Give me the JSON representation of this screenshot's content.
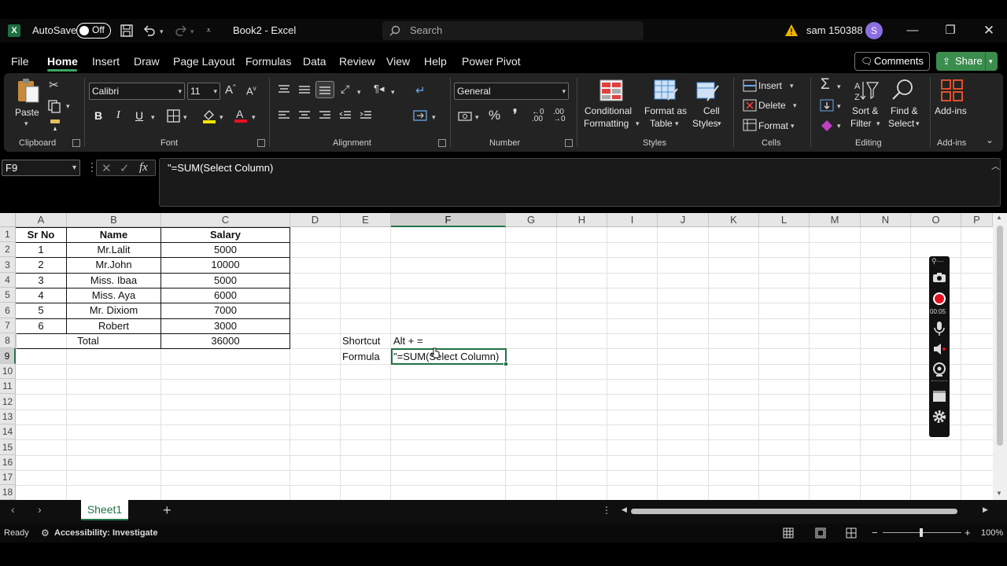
{
  "titlebar": {
    "autosave_label": "AutoSave",
    "autosave_state": "Off",
    "doc_title": "Book2  -  Excel",
    "search_placeholder": "Search",
    "user_name": "sam 150388",
    "avatar_initial": "S"
  },
  "menu": {
    "items": [
      "File",
      "Home",
      "Insert",
      "Draw",
      "Page Layout",
      "Formulas",
      "Data",
      "Review",
      "View",
      "Help",
      "Power Pivot"
    ],
    "active": "Home",
    "comments_label": "Comments",
    "share_label": "Share"
  },
  "ribbon": {
    "clipboard": {
      "paste": "Paste",
      "group": "Clipboard"
    },
    "font": {
      "name": "Calibri",
      "size": "11",
      "group": "Font",
      "bold": "B",
      "italic": "I",
      "underline": "U"
    },
    "alignment": {
      "group": "Alignment"
    },
    "number": {
      "format": "General",
      "group": "Number"
    },
    "styles": {
      "conditional_1": "Conditional",
      "conditional_2": "Formatting",
      "format_table_1": "Format as",
      "format_table_2": "Table",
      "cell_styles_1": "Cell",
      "cell_styles_2": "Styles",
      "group": "Styles"
    },
    "cells": {
      "insert": "Insert",
      "delete": "Delete",
      "format": "Format",
      "group": "Cells"
    },
    "editing": {
      "sort_1": "Sort &",
      "sort_2": "Filter",
      "find_1": "Find &",
      "find_2": "Select",
      "group": "Editing"
    },
    "addins": {
      "label": "Add-ins",
      "group": "Add-ins"
    }
  },
  "formula_bar": {
    "name_box": "F9",
    "formula": "\"=SUM(Select Column)"
  },
  "sheet": {
    "columns": [
      "A",
      "B",
      "C",
      "D",
      "E",
      "F",
      "G",
      "H",
      "I",
      "J",
      "K",
      "L",
      "M",
      "N",
      "O",
      "P"
    ],
    "selected_column": "F",
    "rows": [
      "1",
      "2",
      "3",
      "4",
      "5",
      "6",
      "7",
      "8",
      "9",
      "10",
      "11",
      "12",
      "13",
      "14",
      "15",
      "16",
      "17",
      "18"
    ],
    "selected_row": "9",
    "table": {
      "headers": [
        "Sr No",
        "Name",
        "Salary"
      ],
      "rows": [
        [
          "1",
          "Mr.Lalit",
          "5000"
        ],
        [
          "2",
          "Mr.John",
          "10000"
        ],
        [
          "3",
          "Miss. Ibaa",
          "5000"
        ],
        [
          "4",
          "Miss. Aya",
          "6000"
        ],
        [
          "5",
          "Mr. Dixiom",
          "7000"
        ],
        [
          "6",
          "Robert",
          "3000"
        ]
      ],
      "total_label": "Total",
      "total_value": "36000"
    },
    "notes": {
      "shortcut_label": "Shortcut",
      "shortcut_value": "Alt + =",
      "formula_label": "Formula",
      "formula_value": "\"=SUM(Select Column)"
    }
  },
  "recorder": {
    "timer": "00:05"
  },
  "sheet_tabs": {
    "active": "Sheet1",
    "add": "+"
  },
  "status": {
    "ready": "Ready",
    "accessibility": "Accessibility: Investigate",
    "zoom": "100%"
  },
  "colors": {
    "accent": "#217346",
    "share": "#3b8d4e",
    "record": "#e81123"
  }
}
